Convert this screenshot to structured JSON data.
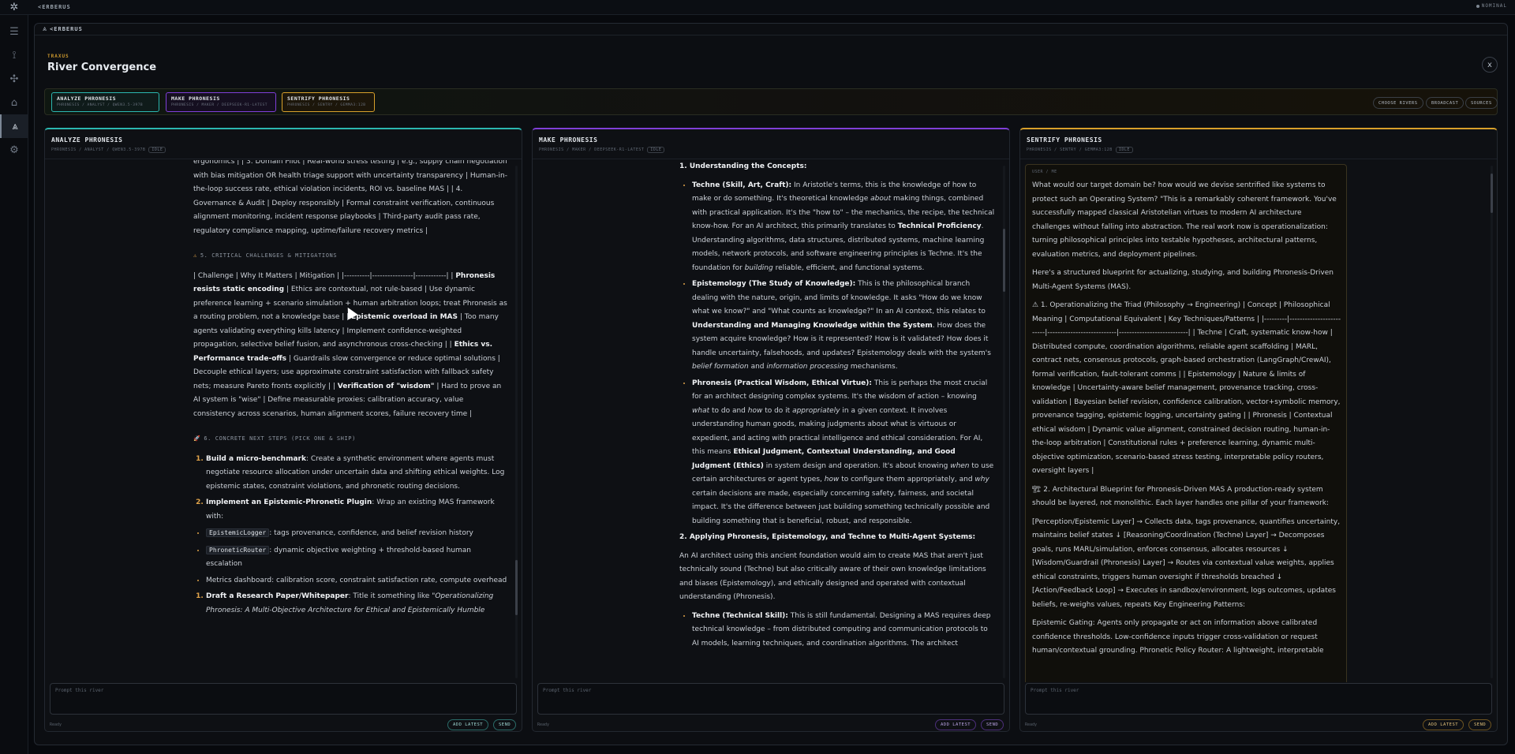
{
  "topbar": {
    "brand": "<ERBERUS",
    "status": "NOMINAL"
  },
  "modal": {
    "brand": "<ERBERUS",
    "tag_label": "TRAXUS",
    "title": "River Convergence",
    "close": "x"
  },
  "strip": {
    "chips": [
      {
        "name": "ANALYZE PHRONESIS",
        "sub": "PHRONESIS / ANALYST / QWEN3.5-397B"
      },
      {
        "name": "MAKE PHRONESIS",
        "sub": "PHRONESIS / MAKER / DEEPSEEK-R1-LATEST"
      },
      {
        "name": "SENTRIFY PHRONESIS",
        "sub": "PHRONESIS / SENTRY / GEMMA3:12B"
      }
    ],
    "buttons": [
      "CHOOSE RIVERS",
      "BROADCAST",
      "SOURCES"
    ]
  },
  "panes": [
    {
      "name": "ANALYZE PHRONESIS",
      "sub": "PHRONESIS / ANALYST / QWEN3.5-397B",
      "tag": "IDLE",
      "placeholder": "Prompt this river",
      "ready": "Ready",
      "add_latest": "ADD LATEST",
      "send": "SEND"
    },
    {
      "name": "MAKE PHRONESIS",
      "sub": "PHRONESIS / MAKER / DEEPSEEK-R1-LATEST",
      "tag": "IDLE",
      "placeholder": "Prompt this river",
      "ready": "Ready",
      "add_latest": "ADD LATEST",
      "send": "SEND"
    },
    {
      "name": "SENTRIFY PHRONESIS",
      "sub": "PHRONESIS / SENTRY / GEMMA3:12B",
      "tag": "IDLE",
      "placeholder": "Prompt this river",
      "ready": "Ready",
      "add_latest": "ADD LATEST",
      "send": "SEND"
    }
  ],
  "analyze": {
    "top_text": "ergonomics | | 3. Domain Pilot | Real-world stress testing | e.g., supply chain negotiation with bias mitigation OR health triage support with uncertainty transparency | Human-in-the-loop success rate, ethical violation incidents, ROI vs. baseline MAS | | 4. Governance & Audit | Deploy responsibly | Formal constraint verification, continuous alignment monitoring, incident response playbooks | Third-party audit pass rate, regulatory compliance mapping, uptime/failure recovery metrics |",
    "sec5": "5. CRITICAL CHALLENGES & MITIGATIONS",
    "sec5_text_a": "| Challenge | Why It Matters | Mitigation | |----------|----------------|------------| |",
    "sec5_b1": "Phronesis resists static encoding",
    "sec5_t1": "| Ethics are contextual, not rule-based | Use dynamic preference learning + scenario simulation + human arbitration loops; treat Phronesis as a routing problem, not a knowledge base | |",
    "sec5_b2": "Epistemic overload in MAS",
    "sec5_t2": "| Too many agents validating everything kills latency | Implement confidence-weighted propagation, selective belief fusion, and asynchronous cross-checking | |",
    "sec5_b3": "Ethics vs. Performance trade-offs",
    "sec5_t3": "| Guardrails slow convergence or reduce optimal solutions | Decouple ethical layers; use approximate constraint satisfaction with fallback safety nets; measure Pareto fronts explicitly | |",
    "sec5_b4": "Verification of \"wisdom\"",
    "sec5_t4": "| Hard to prove an AI system is \"wise\" | Define measurable proxies: calibration accuracy, value consistency across scenarios, human alignment scores, failure recovery time |",
    "sec6": "6. CONCRETE NEXT STEPS (PICK ONE & SHIP)",
    "step1_b": "Build a micro-benchmark",
    "step1_t": ": Create a synthetic environment where agents must negotiate resource allocation under uncertain data and shifting ethical weights. Log epistemic states, constraint violations, and phronetic routing decisions.",
    "step2_b": "Implement an Epistemic-Phronetic Plugin",
    "step2_t": ": Wrap an existing MAS framework with:",
    "bul1_code": "EpistemicLogger",
    "bul1_t": ": tags provenance, confidence, and belief revision history",
    "bul2_code": "PhroneticRouter",
    "bul2_t": ": dynamic objective weighting + threshold-based human escalation",
    "bul3_t": "Metrics dashboard: calibration score, constraint satisfaction rate, compute overhead",
    "step3_b": "Draft a Research Paper/Whitepaper",
    "step3_t": ": Title it something like ",
    "step3_i": "\"Operationalizing Phronesis: A Multi-Objective Architecture for Ethical and Epistemically Humble"
  },
  "make": {
    "h1": "1. Understanding the Concepts:",
    "techne_b": "Techne (Skill, Art, Craft):",
    "techne_t1": " In Aristotle's terms, this is the knowledge of how to make or do something. It's theoretical knowledge ",
    "techne_i1": "about",
    "techne_t2": " making things, combined with practical application. It's the \"how to\" – the mechanics, the recipe, the technical know-how. For an AI architect, this primarily translates to ",
    "techne_b2": "Technical Proficiency",
    "techne_t3": ". Understanding algorithms, data structures, distributed systems, machine learning models, network protocols, and software engineering principles is Techne. It's the foundation for ",
    "techne_i2": "building",
    "techne_t4": " reliable, efficient, and functional systems.",
    "epi_b": "Epistemology (The Study of Knowledge):",
    "epi_t1": " This is the philosophical branch dealing with the nature, origin, and limits of knowledge. It asks \"How do we know what we know?\" and \"What counts as knowledge?\" In an AI context, this relates to ",
    "epi_b2": "Understanding and Managing Knowledge within the System",
    "epi_t2": ". How does the system acquire knowledge? How is it represented? How is it validated? How does it handle uncertainty, falsehoods, and updates? Epistemology deals with the system's ",
    "epi_i1": "belief formation",
    "epi_t3": " and ",
    "epi_i2": "information processing",
    "epi_t4": " mechanisms.",
    "phr_b": "Phronesis (Practical Wisdom, Ethical Virtue):",
    "phr_t1": " This is perhaps the most crucial for an architect designing complex systems. It's the wisdom of action – knowing ",
    "phr_i1": "what",
    "phr_t2": " to do and ",
    "phr_i2": "how",
    "phr_t3": " to do it ",
    "phr_i3": "appropriately",
    "phr_t4": " in a given context. It involves understanding human goods, making judgments about what is virtuous or expedient, and acting with practical intelligence and ethical consideration. For AI, this means ",
    "phr_b2": "Ethical Judgment, Contextual Understanding, and Good Judgment (Ethics)",
    "phr_t5": " in system design and operation. It's about knowing ",
    "phr_i4": "when",
    "phr_t6": " to use certain architectures or agent types, ",
    "phr_i5": "how",
    "phr_t7": " to configure them appropriately, and ",
    "phr_i6": "why",
    "phr_t8": " certain decisions are made, especially concerning safety, fairness, and societal impact. It's the difference between just building something technically possible and building something that is beneficial, robust, and responsible.",
    "h2": "2. Applying Phronesis, Epistemology, and Techne to Multi-Agent Systems:",
    "p2": "An AI architect using this ancient foundation would aim to create MAS that aren't just technically sound (Techne) but also critically aware of their own knowledge limitations and biases (Epistemology), and ethically designed and operated with contextual understanding (Phronesis).",
    "tech2_b": "Techne (Technical Skill):",
    "tech2_t": " This is still fundamental. Designing a MAS requires deep technical knowledge – from distributed computing and communication protocols to AI models, learning techniques, and coordination algorithms. The architect"
  },
  "sentrify": {
    "you": "USER / ME",
    "p1": "What would our target domain be? how would we devise sentrified like systems to protect such an Operating System? \"This is a remarkably coherent framework. You've successfully mapped classical Aristotelian virtues to modern AI architecture challenges without falling into abstraction. The real work now is operationalization: turning philosophical principles into testable hypotheses, architectural patterns, evaluation metrics, and deployment pipelines.",
    "p2": "Here's a structured blueprint for actualizing, studying, and building Phronesis-Driven Multi-Agent Systems (MAS).",
    "p3": "⚠ 1. Operationalizing the Triad (Philosophy → Engineering) | Concept | Philosophical Meaning | Computational Equivalent | Key Techniques/Patterns | |---------|-------------------------|---------------------------|---------------------------| | Techne | Craft, systematic know-how | Distributed compute, coordination algorithms, reliable agent scaffolding | MARL, contract nets, consensus protocols, graph-based orchestration (LangGraph/CrewAI), formal verification, fault-tolerant comms | | Epistemology | Nature & limits of knowledge | Uncertainty-aware belief management, provenance tracking, cross-validation | Bayesian belief revision, confidence calibration, vector+symbolic memory, provenance tagging, epistemic logging, uncertainty gating | | Phronesis | Contextual ethical wisdom | Dynamic value alignment, constrained decision routing, human-in-the-loop arbitration | Constitutional rules + preference learning, dynamic multi-objective optimization, scenario-based stress testing, interpretable policy routers, oversight layers |",
    "p4": "🏗 2. Architectural Blueprint for Phronesis-Driven MAS A production-ready system should be layered, not monolithic. Each layer handles one pillar of your framework:",
    "p5": "[Perception/Epistemic Layer] → Collects data, tags provenance, quantifies uncertainty, maintains belief states ↓ [Reasoning/Coordination (Techne) Layer] → Decomposes goals, runs MARL/simulation, enforces consensus, allocates resources ↓ [Wisdom/Guardrail (Phronesis) Layer] → Routes via contextual value weights, applies ethical constraints, triggers human oversight if thresholds breached ↓ [Action/Feedback Loop] → Executes in sandbox/environment, logs outcomes, updates beliefs, re-weighs values, repeats Key Engineering Patterns:",
    "p6": "Epistemic Gating: Agents only propagate or act on information above calibrated confidence thresholds. Low-confidence inputs trigger cross-validation or request human/contextual grounding. Phronetic Policy Router: A lightweight, interpretable"
  }
}
